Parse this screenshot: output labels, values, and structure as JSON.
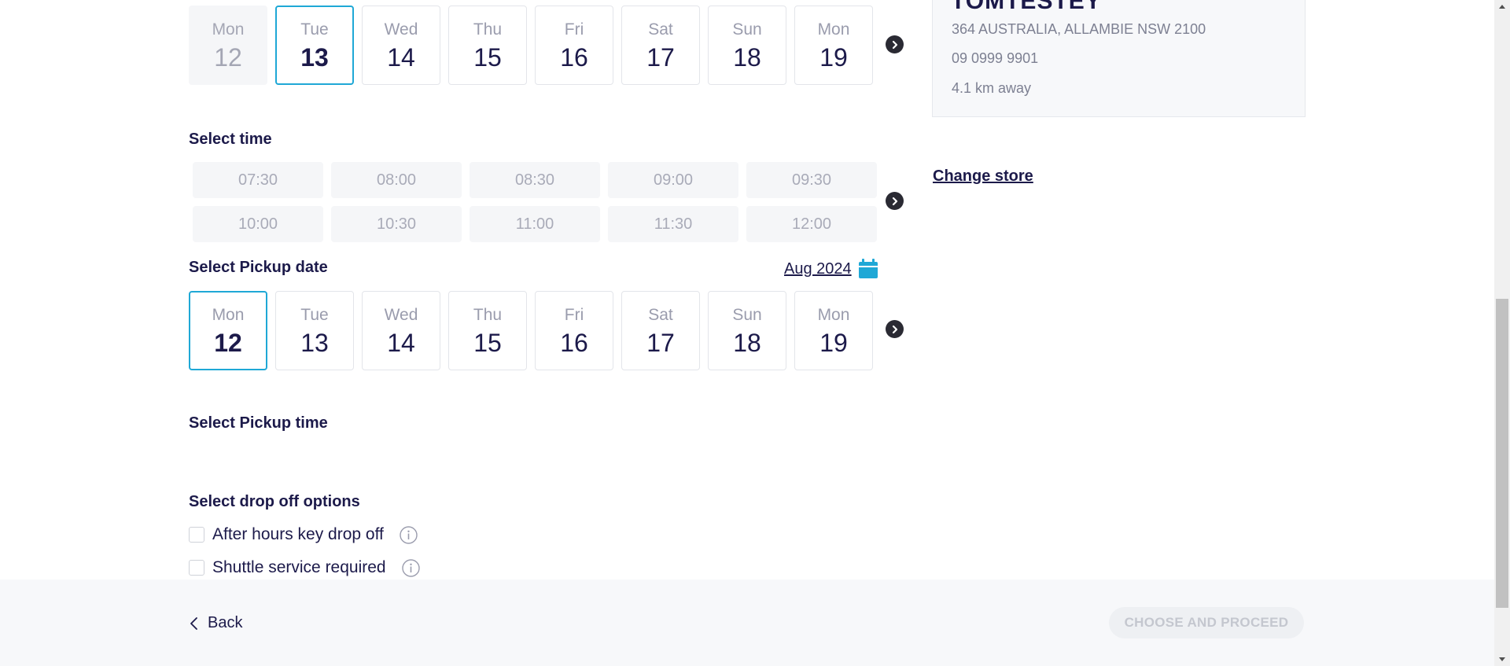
{
  "drop_date": {
    "days": [
      {
        "name": "Mon",
        "num": "12",
        "state": "disabled"
      },
      {
        "name": "Tue",
        "num": "13",
        "state": "selected"
      },
      {
        "name": "Wed",
        "num": "14",
        "state": ""
      },
      {
        "name": "Thu",
        "num": "15",
        "state": ""
      },
      {
        "name": "Fri",
        "num": "16",
        "state": ""
      },
      {
        "name": "Sat",
        "num": "17",
        "state": ""
      },
      {
        "name": "Sun",
        "num": "18",
        "state": ""
      },
      {
        "name": "Mon",
        "num": "19",
        "state": ""
      }
    ]
  },
  "time": {
    "title": "Select time",
    "slots": [
      "07:30",
      "08:00",
      "08:30",
      "09:00",
      "09:30",
      "10:00",
      "10:30",
      "11:00",
      "11:30",
      "12:00"
    ]
  },
  "pickup_date": {
    "title": "Select Pickup date",
    "month_label": "Aug 2024",
    "days": [
      {
        "name": "Mon",
        "num": "12",
        "state": "selected"
      },
      {
        "name": "Tue",
        "num": "13",
        "state": ""
      },
      {
        "name": "Wed",
        "num": "14",
        "state": ""
      },
      {
        "name": "Thu",
        "num": "15",
        "state": ""
      },
      {
        "name": "Fri",
        "num": "16",
        "state": ""
      },
      {
        "name": "Sat",
        "num": "17",
        "state": ""
      },
      {
        "name": "Sun",
        "num": "18",
        "state": ""
      },
      {
        "name": "Mon",
        "num": "19",
        "state": ""
      }
    ]
  },
  "pickup_time": {
    "title": "Select Pickup time"
  },
  "drop_off": {
    "title": "Select drop off options",
    "options": [
      "After hours key drop off",
      "Shuttle service required"
    ]
  },
  "store": {
    "name": "TOMTESTEY",
    "address": "364 AUSTRALIA, ALLAMBIE NSW 2100",
    "phone": "09 0999 9901",
    "distance": "4.1 km away",
    "change_label": "Change store"
  },
  "footer": {
    "back_label": "Back",
    "proceed_label": "CHOOSE AND PROCEED"
  },
  "colors": {
    "accent": "#1fa8d6",
    "text": "#1c1a4a"
  },
  "icons": {
    "next": "chevron-right-circle-icon",
    "calendar": "calendar-icon",
    "info": "info-icon",
    "back": "chevron-left-icon"
  }
}
